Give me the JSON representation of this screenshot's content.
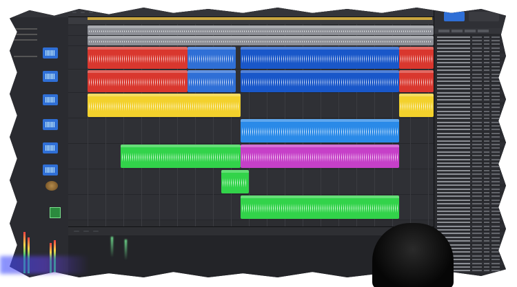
{
  "window": {
    "title": ""
  },
  "colors": {
    "regionRed": "#d9372e",
    "regionBlue": "#2f6fd6",
    "regionBlueDeep": "#1957c9",
    "regionYellow": "#f3d12c",
    "regionCyan": "#2a8ae8",
    "regionGreen": "#32d34a",
    "regionMagenta": "#c640c8",
    "regionGray": "#8d8f96",
    "accentBlue": "#2f6fd6"
  },
  "icons": [
    "waveform-icon",
    "drum-kit-icon",
    "green-track-icon",
    "volume-meter-icon"
  ]
}
